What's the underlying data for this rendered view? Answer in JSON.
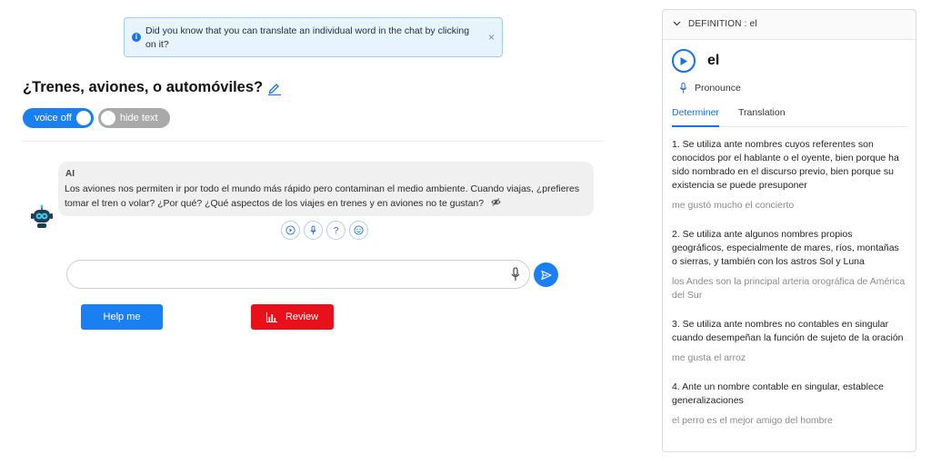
{
  "tip": {
    "text": "Did you know that you can translate an individual word in the chat by clicking on it?",
    "close": "×"
  },
  "lesson": {
    "title": "¿Trenes, aviones, o automóviles?"
  },
  "toggles": {
    "voice_label": "voice off",
    "hide_label": "hide text"
  },
  "chat": {
    "author": "AI",
    "message": "Los aviones nos permiten ir por todo el mundo más rápido pero contaminan el medio ambiente. Cuando viajas, ¿prefieres tomar el tren o volar? ¿Por qué? ¿Qué aspectos de los viajes en trenes y en aviones no te gustan?"
  },
  "composer": {
    "value": "",
    "placeholder": ""
  },
  "buttons": {
    "help": "Help me",
    "review": "Review"
  },
  "definition": {
    "header": "DEFINITION : el",
    "word": "el",
    "pronounce": "Pronounce",
    "tabs": [
      "Determiner",
      "Translation"
    ],
    "entries": [
      {
        "text": "1. Se utiliza ante nombres cuyos referentes son conocidos por el hablante o el oyente, bien porque ha sido nombrado en el discurso previo, bien porque su existencia se puede presuponer",
        "example": "me gustó mucho el concierto"
      },
      {
        "text": "2. Se utiliza ante algunos nombres propios geográficos, especialmente de mares, ríos, montañas o sierras, y también con los astros Sol y Luna",
        "example": "los Andes son la principal arteria orográfica de América del Sur"
      },
      {
        "text": "3. Se utiliza ante nombres no contables en singular cuando desempeñan la función de sujeto de la oración",
        "example": "me gusta el arroz"
      },
      {
        "text": "4. Ante un nombre contable en singular, establece generalizaciones",
        "example": "el perro es el mejor amigo del hombre"
      }
    ]
  },
  "colors": {
    "accent": "#1a7ff0",
    "review": "#e8101a",
    "tip_bg": "#e7f3fd",
    "toggle_off": "#a9a9a9"
  },
  "icons": {
    "tip": "info-icon",
    "title_edit": "pencil-icon",
    "avatar": "robot-avatar-icon",
    "hide_message": "eye-slash-icon",
    "actions": [
      "play-icon",
      "microphone-icon",
      "question-icon",
      "smiley-icon"
    ],
    "send": "send-icon",
    "review": "bar-chart-icon",
    "panel_toggle": "chevron-down-icon",
    "pronounce": "microphone-icon"
  }
}
